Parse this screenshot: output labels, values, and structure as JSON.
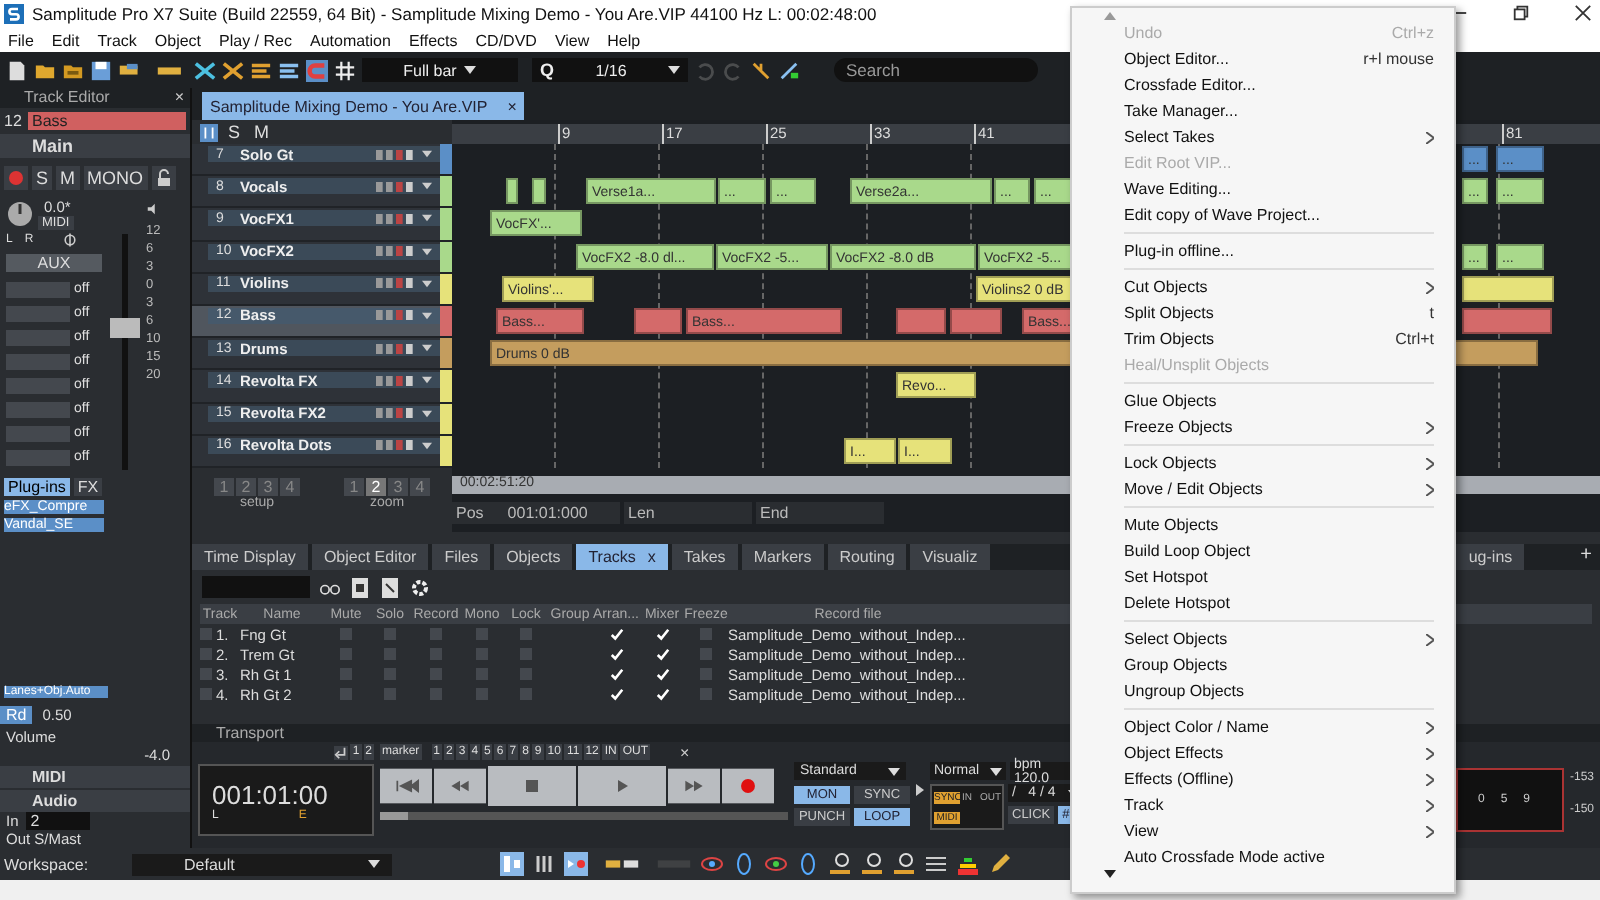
{
  "window": {
    "title": "Samplitude Pro X7 Suite (Build 22559, 64 Bit)  -  Samplitude Mixing Demo - You Are.VIP   44100 Hz L: 00:02:48:00"
  },
  "menu_bar": [
    "File",
    "Edit",
    "Track",
    "Object",
    "Play / Rec",
    "Automation",
    "Effects",
    "CD/DVD",
    "View",
    "Help"
  ],
  "toolbar": {
    "snap_mode": "Full bar",
    "quantize_label": "Q",
    "quantize": "1/16",
    "search": {
      "placeholder": "Search"
    }
  },
  "track_editor": {
    "title": "Track Editor",
    "close": "×",
    "track_number": "12",
    "track_name": "Bass",
    "section": "Main",
    "buttons": [
      "S",
      "M",
      "MONO"
    ],
    "pan": "0.0*",
    "midi": "MIDI",
    "pan_left": "L",
    "pan_right": "R",
    "aux": "AUX",
    "aux_slots": [
      "off",
      "off",
      "off",
      "off",
      "off",
      "off",
      "off",
      "off"
    ],
    "fader": {
      "level": 0.6
    },
    "fader_scale": [
      "12",
      "6",
      "3",
      "0",
      "3",
      "6",
      "10",
      "15",
      "20"
    ],
    "plugin_tab": "Plug-ins",
    "fx": "FX",
    "plugins": [
      "eFX_Compre",
      "Vandal_SE"
    ],
    "lanes": "Lanes+Obj.Auto",
    "read_mode": "Rd",
    "read_value": "0.50",
    "volume_label": "Volume",
    "volume": "-4.0",
    "sections": [
      "MIDI",
      "Audio"
    ],
    "input_label": "In",
    "input": "2",
    "output": "Out S/Mast"
  },
  "project_tab": {
    "title": "Samplitude Mixing Demo - You Are.VIP",
    "close": "×"
  },
  "track_header_buttons": [
    "S",
    "M"
  ],
  "tracks": [
    {
      "number": "7",
      "name": "Solo Gt",
      "color": "#5b8fc7",
      "selected": false,
      "clips": [
        {
          "kind": "audio",
          "label": "..."
        },
        {
          "kind": "audio",
          "label": "..."
        }
      ]
    },
    {
      "number": "8",
      "name": "Vocals",
      "color": "#a9d98b",
      "selected": false,
      "clips": [
        {
          "kind": "audio"
        },
        {
          "kind": "audio"
        },
        {
          "kind": "audio",
          "label": "Verse1a..."
        },
        {
          "kind": "audio",
          "label": "..."
        },
        {
          "kind": "audio",
          "label": "..."
        },
        {
          "kind": "audio",
          "label": "Verse2a..."
        },
        {
          "kind": "audio",
          "label": "..."
        },
        {
          "kind": "audio",
          "label": "..."
        },
        {
          "kind": "audio",
          "label": "..."
        },
        {
          "kind": "audio",
          "label": "..."
        }
      ]
    },
    {
      "number": "9",
      "name": "VocFX1",
      "color": "#a9d98b",
      "selected": false,
      "clips": [
        {
          "kind": "audio",
          "label": "VocFX'..."
        }
      ]
    },
    {
      "number": "10",
      "name": "VocFX2",
      "color": "#a9d98b",
      "selected": false,
      "clips": [
        {
          "kind": "audio",
          "label": "VocFX2  -8.0 dl..."
        },
        {
          "kind": "audio",
          "label": "VocFX2  -5..."
        },
        {
          "kind": "audio",
          "label": "VocFX2  -8.0 dB"
        },
        {
          "kind": "audio",
          "label": "VocFX2  -5..."
        },
        {
          "kind": "audio",
          "label": "..."
        },
        {
          "kind": "audio",
          "label": "..."
        }
      ]
    },
    {
      "number": "11",
      "name": "Violins",
      "color": "#e6e27a",
      "selected": false,
      "clips": [
        {
          "kind": "audio",
          "label": "Violins'..."
        },
        {
          "kind": "audio",
          "label": "Violins2  0 dB"
        },
        {
          "kind": "audio"
        }
      ]
    },
    {
      "number": "12",
      "name": "Bass",
      "color": "#d46a6a",
      "selected": true,
      "clips": [
        {
          "kind": "audio",
          "label": "Bass..."
        },
        {
          "kind": "audio"
        },
        {
          "kind": "audio",
          "label": "Bass..."
        },
        {
          "kind": "audio"
        },
        {
          "kind": "audio"
        },
        {
          "kind": "audio",
          "label": "Bass..."
        },
        {
          "kind": "audio"
        }
      ]
    },
    {
      "number": "13",
      "name": "Drums",
      "color": "#c49d5e",
      "selected": false,
      "clips": [
        {
          "kind": "audio",
          "label": "Drums  0 dB"
        }
      ]
    },
    {
      "number": "14",
      "name": "Revolta FX",
      "color": "#e6e27a",
      "selected": false,
      "clips": [
        {
          "kind": "audio",
          "label": "Revo..."
        }
      ]
    },
    {
      "number": "15",
      "name": "Revolta FX2",
      "color": "#e6e27a",
      "selected": false
    },
    {
      "number": "16",
      "name": "Revolta Dots",
      "color": "#e6e27a",
      "selected": false,
      "clips": [
        {
          "kind": "audio",
          "label": "I..."
        },
        {
          "kind": "audio",
          "label": "I..."
        }
      ]
    }
  ],
  "ruler": [
    "9",
    "17",
    "25",
    "33",
    "41",
    "81"
  ],
  "setup": {
    "label": "setup",
    "buttons": [
      {
        "label": "1",
        "selected": false
      },
      {
        "label": "2",
        "selected": false
      },
      {
        "label": "3",
        "selected": false
      },
      {
        "label": "4",
        "selected": false
      }
    ]
  },
  "zoom": {
    "label": "zoom",
    "buttons": [
      {
        "label": "1",
        "selected": false
      },
      {
        "label": "2",
        "selected": true
      },
      {
        "label": "3",
        "selected": false
      },
      {
        "label": "4",
        "selected": false
      }
    ]
  },
  "arrange_footer": {
    "time": "00:02:51:20",
    "pos_label": "Pos",
    "pos": "001:01:000",
    "len_label": "Len",
    "end_label": "End"
  },
  "dock": {
    "tabs": [
      {
        "label": "Time Display",
        "selected": false
      },
      {
        "label": "Object Editor",
        "selected": false
      },
      {
        "label": "Files",
        "selected": false
      },
      {
        "label": "Objects",
        "selected": false
      },
      {
        "label": "Tracks",
        "selected": true,
        "close": "x"
      },
      {
        "label": "Takes",
        "selected": false
      },
      {
        "label": "Markers",
        "selected": false
      },
      {
        "label": "Routing",
        "selected": false
      },
      {
        "label": "Visualiz",
        "selected": false
      },
      {
        "label": "ug-ins",
        "selected": false
      }
    ],
    "add_button": "+",
    "columns": [
      "Track",
      "Name",
      "Mute",
      "Solo",
      "Record",
      "Mono",
      "Lock",
      "Group",
      "Arran...",
      "Mixer",
      "Freeze",
      "Record file"
    ],
    "rows": [
      {
        "track": "1.",
        "selected": false,
        "name": "Fng Gt",
        "mute": false,
        "solo": false,
        "record": false,
        "mono": false,
        "lock": false,
        "arranger": true,
        "mixer": true,
        "freeze": false,
        "record_file": "Samplitude_Demo_without_Indep..."
      },
      {
        "track": "2.",
        "selected": false,
        "name": "Trem Gt",
        "mute": false,
        "solo": false,
        "record": false,
        "mono": false,
        "lock": false,
        "arranger": true,
        "mixer": true,
        "freeze": false,
        "record_file": "Samplitude_Demo_without_Indep..."
      },
      {
        "track": "3.",
        "selected": false,
        "name": "Rh Gt 1",
        "mute": false,
        "solo": false,
        "record": false,
        "mono": false,
        "lock": false,
        "arranger": true,
        "mixer": true,
        "freeze": false,
        "record_file": "Samplitude_Demo_without_Indep..."
      },
      {
        "track": "4.",
        "selected": false,
        "name": "Rh Gt 2",
        "mute": false,
        "solo": false,
        "record": false,
        "mono": false,
        "lock": false,
        "arranger": true,
        "mixer": true,
        "freeze": false,
        "record_file": "Samplitude_Demo_without_Indep..."
      }
    ]
  },
  "transport": {
    "title": "Transport",
    "locators": [
      "1",
      "2"
    ],
    "marker_label": "marker",
    "markers": [
      "1",
      "2",
      "3",
      "4",
      "5",
      "6",
      "7",
      "8",
      "9",
      "10",
      "11",
      "12"
    ],
    "in": "IN",
    "out": "OUT",
    "close": "×",
    "time": "001:01:00",
    "left_mark": "L",
    "end_mark": "E",
    "mode": "Standard",
    "buttons": [
      {
        "label": "MON",
        "on": true
      },
      {
        "label": "SYNC",
        "on": false
      },
      {
        "label": "PUNCH",
        "on": false
      },
      {
        "label": "LOOP",
        "on": true
      }
    ],
    "play_mode": "Normal",
    "bpm": "bpm 120.0",
    "signature": "4 / 4",
    "signature_slash": "/",
    "sync": "SYNC",
    "midi": "MIDI",
    "in_label": "IN",
    "out_label": "OUT",
    "click": "CLICK",
    "grid": "#"
  },
  "meter": {
    "scale": [
      "0",
      "5",
      "9"
    ],
    "readings": [
      "-153",
      "-150"
    ]
  },
  "workspace": {
    "label": "Workspace:",
    "value": "Default"
  },
  "context_menu": [
    {
      "kind": "item",
      "label": "Undo",
      "disabled": true,
      "shortcut": "Ctrl+z"
    },
    {
      "kind": "item",
      "label": "Object Editor...",
      "disabled": false,
      "shortcut": "r+l mouse"
    },
    {
      "kind": "item",
      "label": "Crossfade Editor...",
      "disabled": false
    },
    {
      "kind": "item",
      "label": "Take Manager...",
      "disabled": false
    },
    {
      "kind": "item",
      "label": "Select Takes",
      "disabled": false,
      "submenu": true
    },
    {
      "kind": "item",
      "label": "Edit Root VIP...",
      "disabled": true
    },
    {
      "kind": "item",
      "label": "Wave Editing...",
      "disabled": false
    },
    {
      "kind": "item",
      "label": "Edit copy of Wave Project...",
      "disabled": false
    },
    {
      "kind": "separator"
    },
    {
      "kind": "item",
      "label": "Plug-in offline...",
      "disabled": false
    },
    {
      "kind": "separator"
    },
    {
      "kind": "item",
      "label": "Cut Objects",
      "disabled": false,
      "submenu": true
    },
    {
      "kind": "item",
      "label": "Split Objects",
      "disabled": false,
      "shortcut": "t"
    },
    {
      "kind": "item",
      "label": "Trim Objects",
      "disabled": false,
      "shortcut": "Ctrl+t"
    },
    {
      "kind": "item",
      "label": "Heal/Unsplit Objects",
      "disabled": true
    },
    {
      "kind": "separator"
    },
    {
      "kind": "item",
      "label": "Glue Objects",
      "disabled": false
    },
    {
      "kind": "item",
      "label": "Freeze Objects",
      "disabled": false,
      "submenu": true
    },
    {
      "kind": "separator"
    },
    {
      "kind": "item",
      "label": "Lock Objects",
      "disabled": false,
      "submenu": true
    },
    {
      "kind": "item",
      "label": "Move / Edit Objects",
      "disabled": false,
      "submenu": true
    },
    {
      "kind": "separator"
    },
    {
      "kind": "item",
      "label": "Mute Objects",
      "disabled": false
    },
    {
      "kind": "item",
      "label": "Build Loop Object",
      "disabled": false
    },
    {
      "kind": "item",
      "label": "Set Hotspot",
      "disabled": false
    },
    {
      "kind": "item",
      "label": "Delete Hotspot",
      "disabled": false
    },
    {
      "kind": "separator"
    },
    {
      "kind": "item",
      "label": "Select Objects",
      "disabled": false,
      "submenu": true
    },
    {
      "kind": "item",
      "label": "Group Objects",
      "disabled": false
    },
    {
      "kind": "item",
      "label": "Ungroup Objects",
      "disabled": false
    },
    {
      "kind": "separator"
    },
    {
      "kind": "item",
      "label": "Object Color / Name",
      "disabled": false,
      "submenu": true
    },
    {
      "kind": "item",
      "label": "Object Effects",
      "disabled": false,
      "submenu": true
    },
    {
      "kind": "item",
      "label": "Effects (Offline)",
      "disabled": false,
      "submenu": true
    },
    {
      "kind": "item",
      "label": "Track",
      "disabled": false,
      "submenu": true
    },
    {
      "kind": "item",
      "label": "View",
      "disabled": false,
      "submenu": true
    },
    {
      "kind": "item",
      "label": "Auto Crossfade Mode active",
      "disabled": false
    }
  ]
}
